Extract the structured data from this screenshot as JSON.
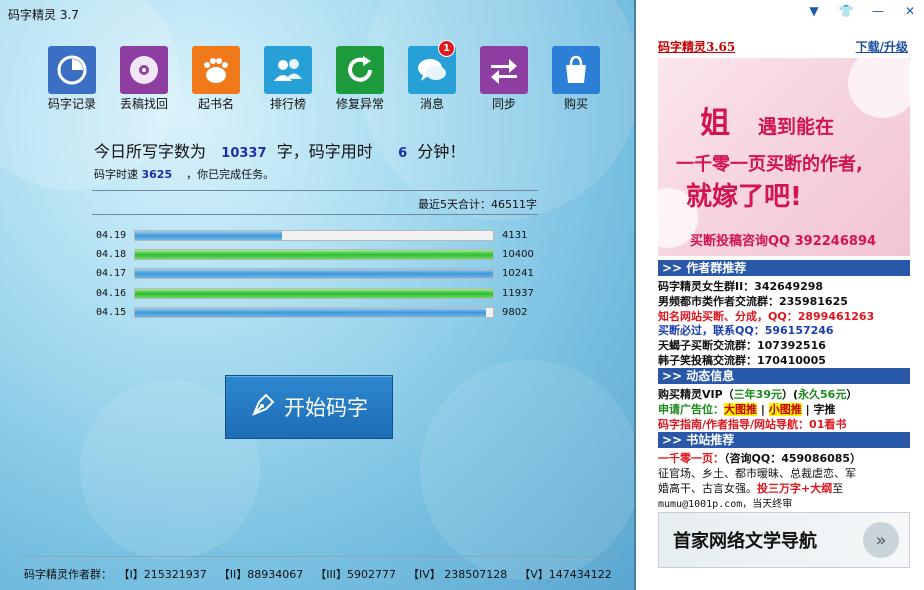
{
  "window": {
    "title": "码字精灵 3.7"
  },
  "toolbar": {
    "items": [
      {
        "label": "码字记录",
        "icon": "chart-dial-icon",
        "color": "#3a6fc4"
      },
      {
        "label": "丢稿找回",
        "icon": "disc-icon",
        "color": "#8e3ea0"
      },
      {
        "label": "起书名",
        "icon": "paw-icon",
        "color": "#f07a1a"
      },
      {
        "label": "排行榜",
        "icon": "users-icon",
        "color": "#27a0d8"
      },
      {
        "label": "修复异常",
        "icon": "refresh-icon",
        "color": "#1d9a3c"
      },
      {
        "label": "消息",
        "icon": "chat-bubble-icon",
        "color": "#27a0d8",
        "badge": "1"
      },
      {
        "label": "同步",
        "icon": "sync-arrows-icon",
        "color": "#8e3ea0"
      },
      {
        "label": "购买",
        "icon": "shopping-bag-icon",
        "color": "#2b7fd4"
      }
    ]
  },
  "today": {
    "prefix": "今日所写字数为",
    "words": "10337",
    "mid": "字，码字用时",
    "minutes": "6",
    "suffix": "分钟！"
  },
  "speed": {
    "prefix": "码字时速",
    "value": "3625",
    "suffix": "，你已完成任务。"
  },
  "recent": {
    "text": "最近5天合计：46511字"
  },
  "history": [
    {
      "date": "04.19",
      "count": "4131",
      "fraction": 0.41,
      "color": "blue"
    },
    {
      "date": "04.18",
      "count": "10400",
      "fraction": 1.0,
      "color": "green"
    },
    {
      "date": "04.17",
      "count": "10241",
      "fraction": 1.0,
      "color": "blue"
    },
    {
      "date": "04.16",
      "count": "11937",
      "fraction": 1.0,
      "color": "green"
    },
    {
      "date": "04.15",
      "count": "9802",
      "fraction": 0.98,
      "color": "blue"
    }
  ],
  "start_button": {
    "label": "开始码字"
  },
  "footer": {
    "label": "码字精灵作者群：",
    "groups": [
      "【I】215321937",
      "【II】88934067",
      "【III】5902777",
      "【IV】 238507128",
      "【V】147434122"
    ]
  },
  "side": {
    "ad_title": "码字精灵3.65",
    "download_link": "下载/升级",
    "banner": {
      "big_char": "姐",
      "line1": "遇到能在",
      "line2": "一千零一页买断的作者,",
      "line3": "就嫁了吧!",
      "contact": "买断投稿咨询QQ 392246894"
    },
    "sections": {
      "authors": {
        "title": ">> 作者群推荐",
        "lines": [
          "码字精灵女生群II：342649298",
          "男频都市类作者交流群：235981625",
          "知名网站买断、分成，QQ：2899461263",
          "买断必过，联系QQ：596157246",
          "天蝎子买断交流群：107392516",
          "韩子笑投稿交流群：170410005"
        ]
      },
      "news": {
        "title": ">> 动态信息",
        "vip_prefix": "购买精灵VIP（",
        "vip_year": "三年39元",
        "vip_mid": "）(",
        "vip_forever": "永久56元",
        "vip_suffix": "）",
        "ad_prefix": "申请广告位：",
        "ad_big": "大图推",
        "ad_sep1": "|",
        "ad_small": "小图推",
        "ad_sep2": "|",
        "ad_text": "字推",
        "guide": "码字指南/作者指导/网站导航：01看书"
      },
      "sites": {
        "title": ">> 书站推荐",
        "l1_red": "一千零一页：",
        "l1_black": "（咨询QQ：459086085）",
        "l2": "征官场、乡土、都市暧昧、总裁虐恋、军",
        "l3_pre": "婚高干、古言女强。",
        "l3_red": "投三万字+大纲",
        "l3_post": "至",
        "l4": "mumu@1001p.com，当天终审"
      }
    },
    "nav_banner": "首家网络文学导航"
  }
}
